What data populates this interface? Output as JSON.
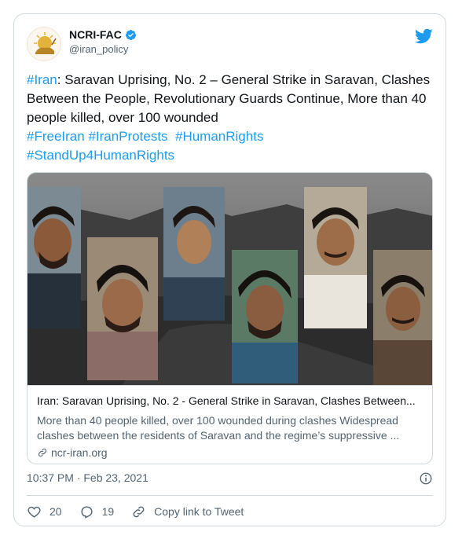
{
  "account": {
    "display_name": "NCRI-FAC",
    "handle": "@iran_policy"
  },
  "tweet": {
    "segments": [
      {
        "text": "#Iran",
        "hashtag": true
      },
      {
        "text": ": Saravan Uprising, No. 2 – General Strike in Saravan, Clashes Between the People, Revolutionary Guards Continue, More than 40 people killed, over 100 wounded",
        "hashtag": false
      },
      {
        "text": "\n",
        "hashtag": false
      },
      {
        "text": "#FreeIran",
        "hashtag": true
      },
      {
        "text": " ",
        "hashtag": false
      },
      {
        "text": "#IranProtests",
        "hashtag": true
      },
      {
        "text": "  ",
        "hashtag": false
      },
      {
        "text": "#HumanRights",
        "hashtag": true
      },
      {
        "text": "\n",
        "hashtag": false
      },
      {
        "text": "#StandUp4HumanRights",
        "hashtag": true
      }
    ]
  },
  "link_card": {
    "title": "Iran: Saravan Uprising, No. 2 - General Strike in Saravan, Clashes Between...",
    "description": "More than 40 people killed, over 100 wounded during clashes Widespread clashes between the residents of Saravan and the regime’s suppressive ...",
    "domain": "ncr-iran.org"
  },
  "meta": {
    "timestamp": "10:37 PM · Feb 23, 2021"
  },
  "actions": {
    "likes": "20",
    "replies": "19",
    "copy_link": "Copy link to Tweet"
  },
  "colors": {
    "accent": "#1d9bf0",
    "secondary_text": "#536471",
    "border": "#cfd9de",
    "like": "#f91880"
  },
  "icons": [
    "verified-badge-icon",
    "twitter-bird-icon",
    "link-icon",
    "info-icon",
    "heart-icon",
    "reply-icon",
    "copy-link-icon"
  ]
}
